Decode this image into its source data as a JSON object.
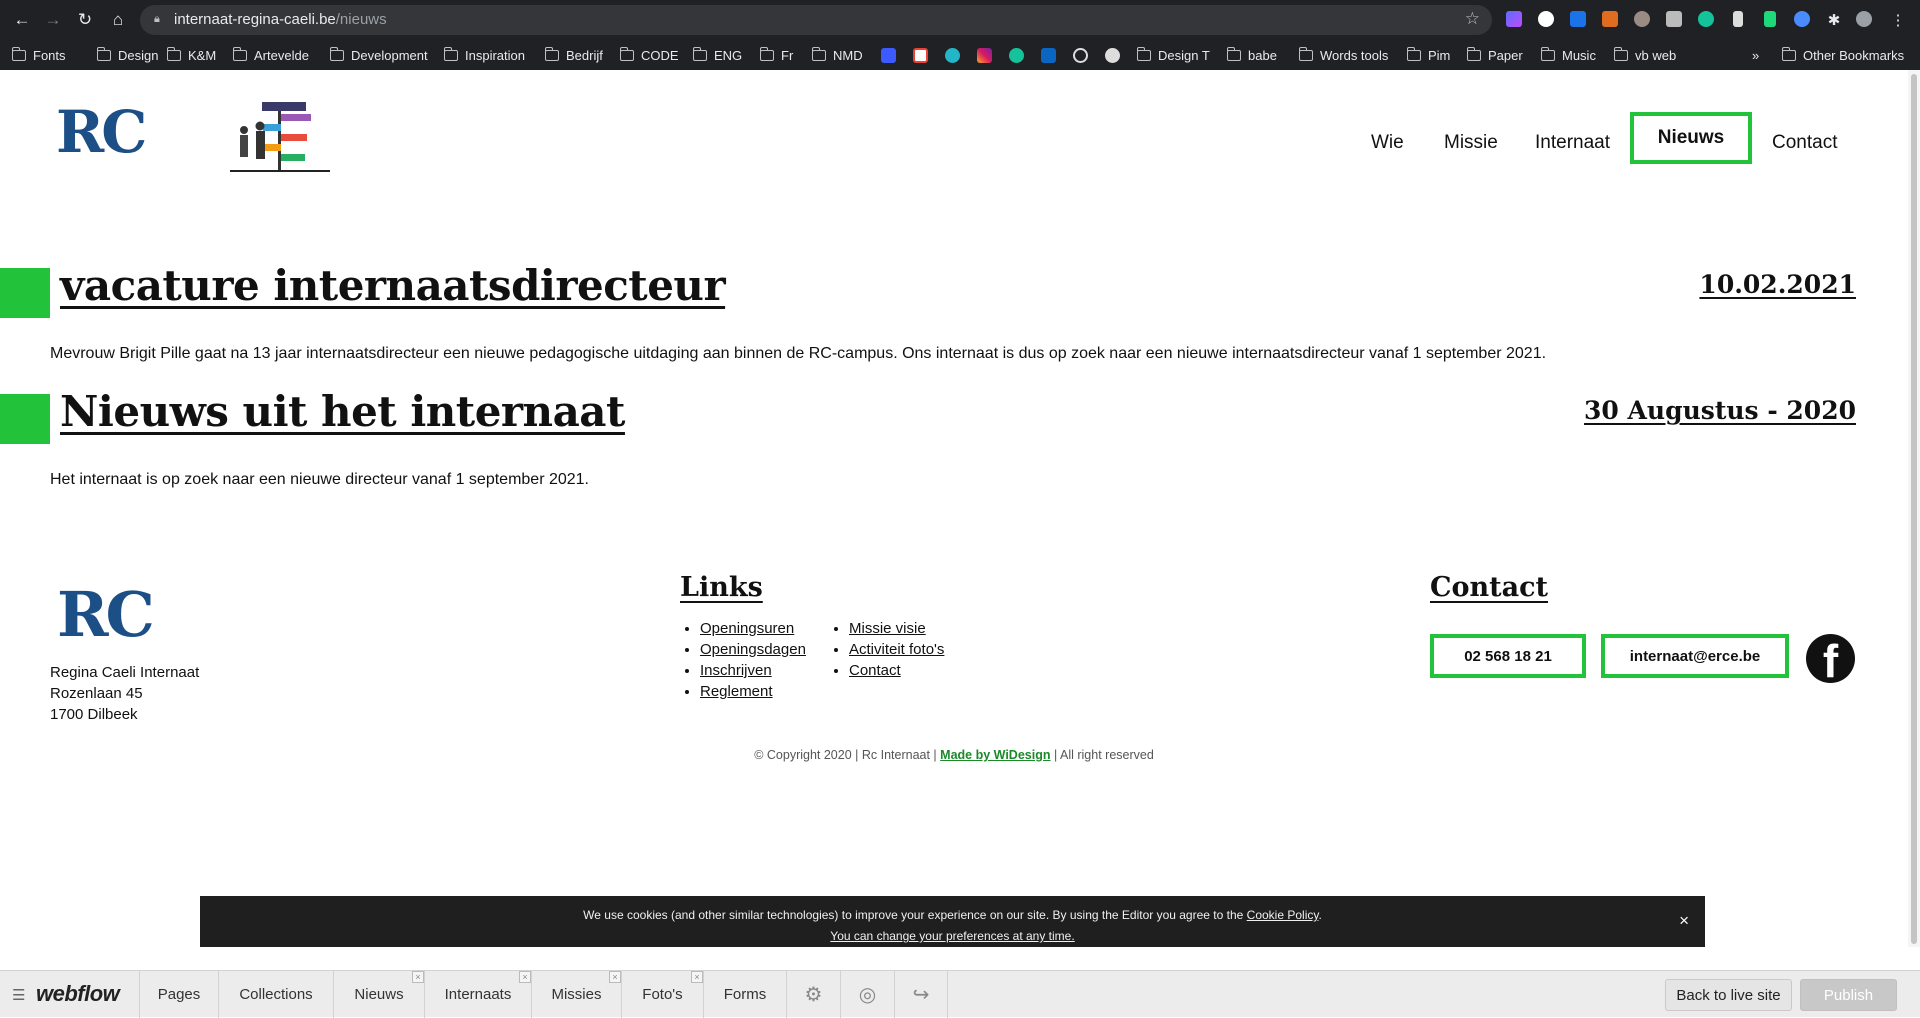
{
  "browser": {
    "url_host": "internaat-regina-caeli.be",
    "url_path": "/nieuws",
    "bookmarks": [
      "Fonts",
      "Design",
      "K&M",
      "Artevelde",
      "Development",
      "Inspiration",
      "Bedrijf",
      "CODE",
      "ENG",
      "Fr",
      "NMD",
      "Design T",
      "babe",
      "Words tools",
      "Pim",
      "Paper",
      "Music",
      "vb web"
    ],
    "more": "»",
    "other_bookmarks": "Other Bookmarks"
  },
  "site": {
    "logo_text": "RC",
    "nav": [
      "Wie",
      "Missie",
      "Internaat",
      "Nieuws",
      "Contact"
    ],
    "active_nav": "Nieuws",
    "accent": "#22c33a"
  },
  "posts": [
    {
      "title": "vacature internaatsdirecteur",
      "date": "10.02.2021",
      "body": "Mevrouw Brigit Pille gaat na 13 jaar internaatsdirecteur een nieuwe pedagogische uitdaging aan binnen de RC-campus. Ons internaat is dus op zoek naar een nieuwe internaatsdirecteur vanaf 1 september 2021."
    },
    {
      "title": "Nieuws uit het internaat",
      "date": "30 Augustus - 2020",
      "body": "Het internaat is op zoek naar een nieuwe directeur vanaf 1 september 2021."
    }
  ],
  "footer": {
    "address": [
      "Regina Caeli Internaat",
      "Rozenlaan 45",
      "1700 Dilbeek"
    ],
    "links_title": "Links",
    "links_col1": [
      "Openingsuren",
      "Openingsdagen",
      "Inschrijven",
      "Reglement"
    ],
    "links_col2": [
      "Missie visie",
      "Activiteit foto's",
      "Contact"
    ],
    "contact_title": "Contact",
    "phone": "02 568 18 21",
    "email": "internaat@erce.be",
    "facebook_glyph": "f",
    "copyright_pre": "© Copyright 2020 |  Rc Internaat |",
    "made_by": "Made by WiDesign",
    "copyright_post": "|  All right reserved"
  },
  "cookie": {
    "text": "We use cookies (and other similar technologies) to improve your experience on our site. By using the Editor you agree to the",
    "policy_link": "Cookie Policy",
    "period": ".",
    "prefs_link": "You can change your preferences at any time.",
    "close": "×"
  },
  "webflow": {
    "logo": "webflow",
    "tabs": [
      "Pages",
      "Collections",
      "Nieuws",
      "Internaats",
      "Missies",
      "Foto's",
      "Forms"
    ],
    "back_label": "Back to live site",
    "publish_label": "Publish"
  }
}
